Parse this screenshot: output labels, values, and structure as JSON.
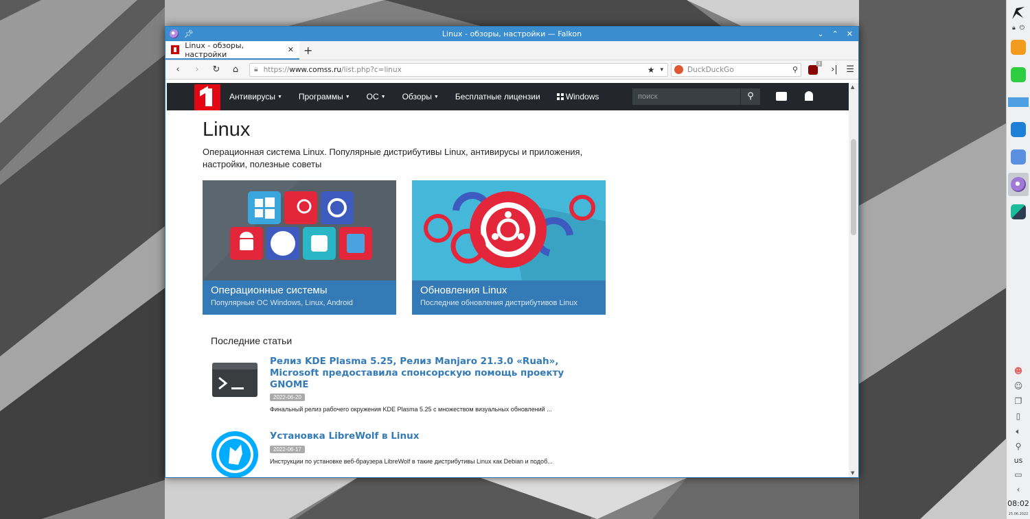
{
  "window": {
    "title": "Linux - обзоры, настройки — Falkon"
  },
  "tabs": [
    {
      "label": "Linux - обзоры, настройки"
    }
  ],
  "navbar": {
    "url_scheme": "https://",
    "url_host": "www.comss.ru",
    "url_path": "/list.php?c=linux",
    "search_engine": "DuckDuckGo",
    "ublock_badge": "3"
  },
  "site": {
    "menu": [
      "Антивирусы",
      "Программы",
      "ОС",
      "Обзоры",
      "Бесплатные лицензии",
      "Windows"
    ],
    "search_placeholder": "поиск"
  },
  "page": {
    "title": "Linux",
    "description": "Операционная система Linux. Популярные дистрибутивы Linux, антивирусы и приложения, настройки, полезные советы"
  },
  "cards": [
    {
      "title": "Операционные системы",
      "subtitle": "Популярные ОС Windows, Linux, Android"
    },
    {
      "title": "Обновления Linux",
      "subtitle": "Последние обновления дистрибутивов Linux"
    }
  ],
  "articles_section": "Последние статьи",
  "articles": [
    {
      "title": "Релиз KDE Plasma 5.25, Релиз Manjaro 21.3.0 «Ruah», Microsoft предоставила спонсорскую помощь проекту GNOME",
      "date": "2022-06-20",
      "description": "Финальный релиз рабочего окружения KDE Plasma 5.25 с множеством визуальных обновлений ..."
    },
    {
      "title": "Установка LibreWolf в Linux",
      "date": "2022-06-17",
      "description": "Инструкции по установке веб-браузера LibreWolf в такие дистрибутивы Linux как Debian и подоб..."
    }
  ],
  "panel": {
    "keyboard_layout": "us",
    "time": "08:02",
    "date": "25.06.2022"
  },
  "colors": {
    "titlebar": "#3a8ed0",
    "site_nav": "#23272b",
    "card_caption": "#337ab7",
    "link": "#337ab7",
    "logo_red": "#e30613"
  }
}
